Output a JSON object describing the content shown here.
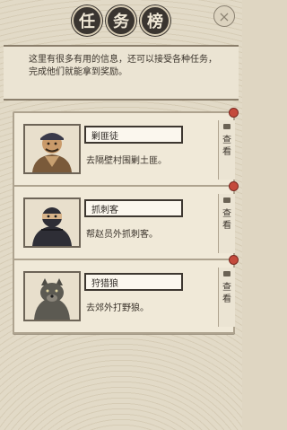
{
  "title": {
    "chars": [
      "任",
      "务",
      "榜"
    ]
  },
  "close_label": "×",
  "intro": "这里有很多有用的信息，还可以接受各种任务，完成他们就能拿到奖励。",
  "tasks": [
    {
      "name": "剿匪徒",
      "desc": "去隔壁村围剿土匪。",
      "view_label": "查看",
      "portrait_icon": "bandit-icon"
    },
    {
      "name": "抓刺客",
      "desc": "帮赵员外抓刺客。",
      "view_label": "查看",
      "portrait_icon": "assassin-icon"
    },
    {
      "name": "狩猎狼",
      "desc": "去郊外打野狼。",
      "view_label": "查看",
      "portrait_icon": "wolf-icon"
    }
  ]
}
